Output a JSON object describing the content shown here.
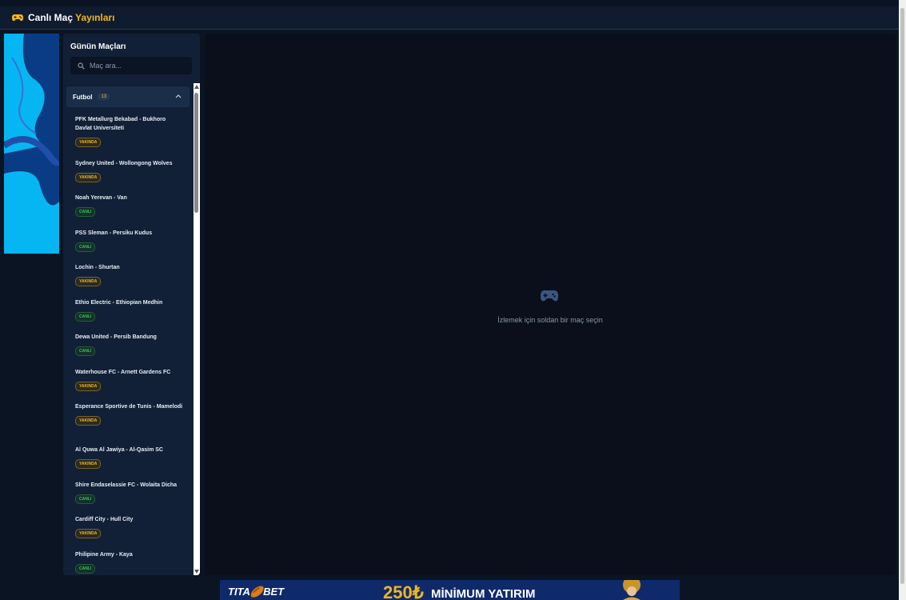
{
  "header": {
    "title_main": "Canlı Maç",
    "title_accent": "Yayınları",
    "icon": "gamepad-icon"
  },
  "sidebar": {
    "title": "Günün Maçları",
    "search_placeholder": "Maç ara...",
    "category": {
      "name": "Futbol",
      "count": "13"
    },
    "matches": [
      {
        "title": "PFK Metallurg Bekabad - Bukhoro Davlat Universiteti",
        "status": "YAKINDA",
        "kind": "soon"
      },
      {
        "title": "Sydney United - Wollongong Wolves",
        "status": "YAKINDA",
        "kind": "soon"
      },
      {
        "title": "Noah Yerevan - Van",
        "status": "CANLI",
        "kind": "live"
      },
      {
        "title": "PSS Sleman - Persiku Kudus",
        "status": "CANLI",
        "kind": "live"
      },
      {
        "title": "Lochin - Shurtan",
        "status": "YAKINDA",
        "kind": "soon"
      },
      {
        "title": "Ethio Electric - Ethiopian Medhin",
        "status": "CANLI",
        "kind": "live"
      },
      {
        "title": "Dewa United - Persib Bandung",
        "status": "CANLI",
        "kind": "live"
      },
      {
        "title": "Waterhouse FC - Arnett Gardens FC",
        "status": "YAKINDA",
        "kind": "soon"
      },
      {
        "title": "Esperance Sportive de Tunis - Mamelodi",
        "status": "YAKINDA",
        "kind": "soon"
      },
      {
        "title": "Al Quwa Al Jawiya - Al-Qasim SC",
        "status": "YAKINDA",
        "kind": "soon"
      },
      {
        "title": "Shire Endaselassie FC - Wolaita Dicha",
        "status": "CANLI",
        "kind": "live"
      },
      {
        "title": "Cardiff City - Hull City",
        "status": "YAKINDA",
        "kind": "soon"
      },
      {
        "title": "Philipine Army - Kaya",
        "status": "CANLI",
        "kind": "live"
      }
    ]
  },
  "player": {
    "empty_text": "İzlemek için soldan bir maç seçin",
    "icon": "gamepad-icon"
  },
  "banner": {
    "brand": "TITA🏉BET",
    "amount": "250₺",
    "offer": "MİNİMUM YATIRIM"
  },
  "colors": {
    "accent": "#f2b51d",
    "live": "#38c35a",
    "background": "#0b1423",
    "panel": "#112036"
  }
}
